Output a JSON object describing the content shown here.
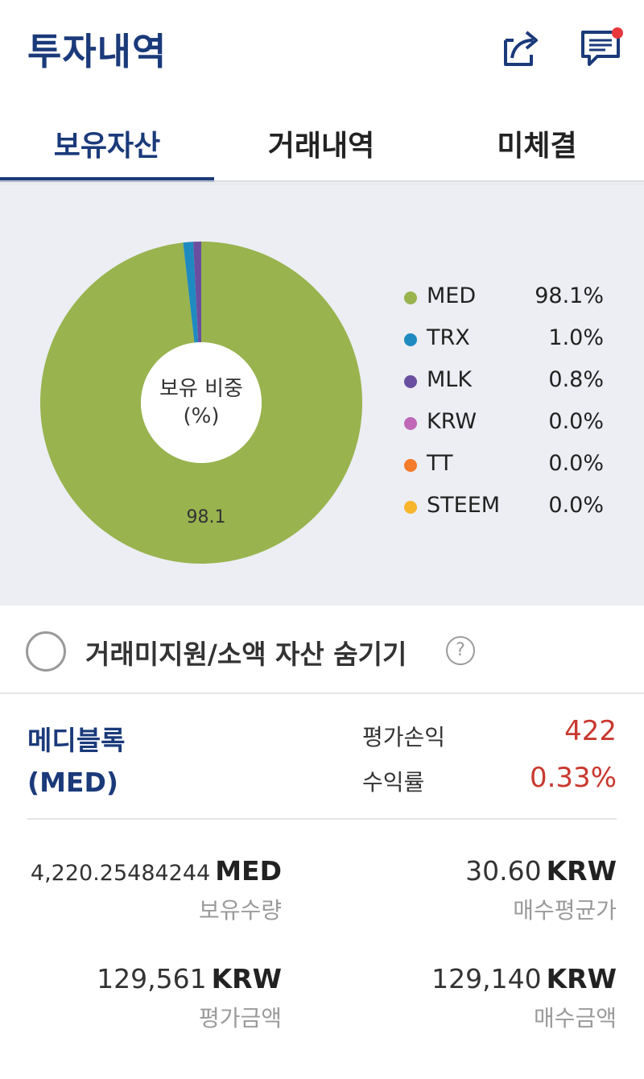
{
  "header": {
    "title": "투자내역",
    "share_icon": "share-icon",
    "chat_icon": "chat-icon",
    "notification_color": "#e8383d"
  },
  "tabs": [
    {
      "label": "보유자산",
      "active": true
    },
    {
      "label": "거래내역",
      "active": false
    },
    {
      "label": "미체결",
      "active": false
    }
  ],
  "chart": {
    "center_line1": "보유 비중",
    "center_line2": "(%)",
    "slice_label": "98.1"
  },
  "chart_data": {
    "type": "pie",
    "categories": [
      "MED",
      "TRX",
      "MLK",
      "KRW",
      "TT",
      "STEEM"
    ],
    "values": [
      98.1,
      1.0,
      0.8,
      0.0,
      0.0,
      0.0
    ],
    "labels": [
      "98.1%",
      "1.0%",
      "0.8%",
      "0.0%",
      "0.0%",
      "0.0%"
    ],
    "colors": [
      "#99b34e",
      "#1f8ac0",
      "#6a4fa0",
      "#c067b8",
      "#f47b2a",
      "#f7b52c"
    ],
    "legend": "right"
  },
  "filter": {
    "label": "거래미지원/소액 자산 숨기기",
    "help_symbol": "?",
    "checked": false
  },
  "asset": {
    "name_line1": "메디블록",
    "name_line2": "(MED)",
    "profit_label": "평가손익",
    "profit_value": "422",
    "return_label": "수익률",
    "return_value": "0.33%",
    "holding_qty": "4,220.25484244",
    "holding_unit": "MED",
    "holding_label": "보유수량",
    "avg_price": "30.60",
    "avg_unit": "KRW",
    "avg_label": "매수평균가",
    "eval_amount": "129,561",
    "eval_unit": "KRW",
    "eval_label": "평가금액",
    "buy_amount": "129,140",
    "buy_unit": "KRW",
    "buy_label": "매수금액"
  }
}
